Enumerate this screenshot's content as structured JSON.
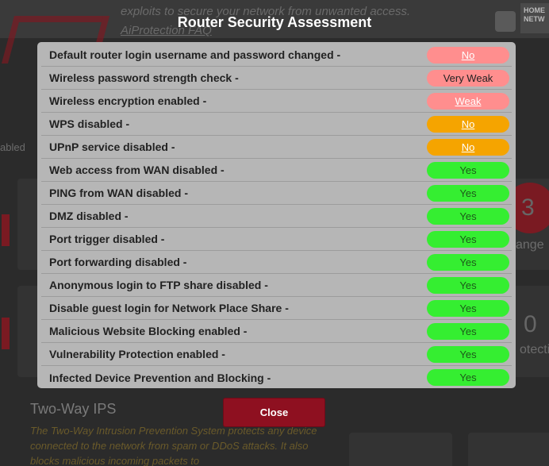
{
  "background": {
    "header_text": "exploits to secure your network from unwanted access.",
    "faq_link": "AiProtection FAQ",
    "home_network_lines": [
      "HOME",
      "NETW"
    ],
    "left_stub": "abled",
    "side_digit_top": "3",
    "side_label_top": "ange",
    "side_digit_bottom": "0",
    "side_label_bottom": "otectio",
    "ips_title": "Two-Way IPS",
    "ips_description": "The Two-Way Intrusion Prevention System protects any device connected to the network from spam or DDoS attacks. It also blocks malicious incoming packets to"
  },
  "modal": {
    "title": "Router Security Assessment",
    "close_label": "Close",
    "rows": [
      {
        "label": "Default router login username and password changed -",
        "status": "No",
        "style": "no-red"
      },
      {
        "label": "Wireless password strength check -",
        "status": "Very Weak",
        "style": "weak-text"
      },
      {
        "label": "Wireless encryption enabled -",
        "status": "Weak",
        "style": "no-red"
      },
      {
        "label": "WPS disabled -",
        "status": "No",
        "style": "no-orange"
      },
      {
        "label": "UPnP service disabled -",
        "status": "No",
        "style": "no-orange"
      },
      {
        "label": "Web access from WAN disabled -",
        "status": "Yes",
        "style": "yes"
      },
      {
        "label": "PING from WAN disabled -",
        "status": "Yes",
        "style": "yes"
      },
      {
        "label": "DMZ disabled -",
        "status": "Yes",
        "style": "yes"
      },
      {
        "label": "Port trigger disabled -",
        "status": "Yes",
        "style": "yes"
      },
      {
        "label": "Port forwarding disabled -",
        "status": "Yes",
        "style": "yes"
      },
      {
        "label": "Anonymous login to FTP share disabled -",
        "status": "Yes",
        "style": "yes"
      },
      {
        "label": "Disable guest login for Network Place Share -",
        "status": "Yes",
        "style": "yes"
      },
      {
        "label": "Malicious Website Blocking enabled -",
        "status": "Yes",
        "style": "yes"
      },
      {
        "label": "Vulnerability Protection enabled -",
        "status": "Yes",
        "style": "yes"
      },
      {
        "label": "Infected Device Prevention and Blocking -",
        "status": "Yes",
        "style": "yes"
      }
    ]
  },
  "colors": {
    "yes": "#35ee31",
    "no_red": "#ff8e8e",
    "no_orange": "#f5a400",
    "close_button": "#8e1020"
  }
}
